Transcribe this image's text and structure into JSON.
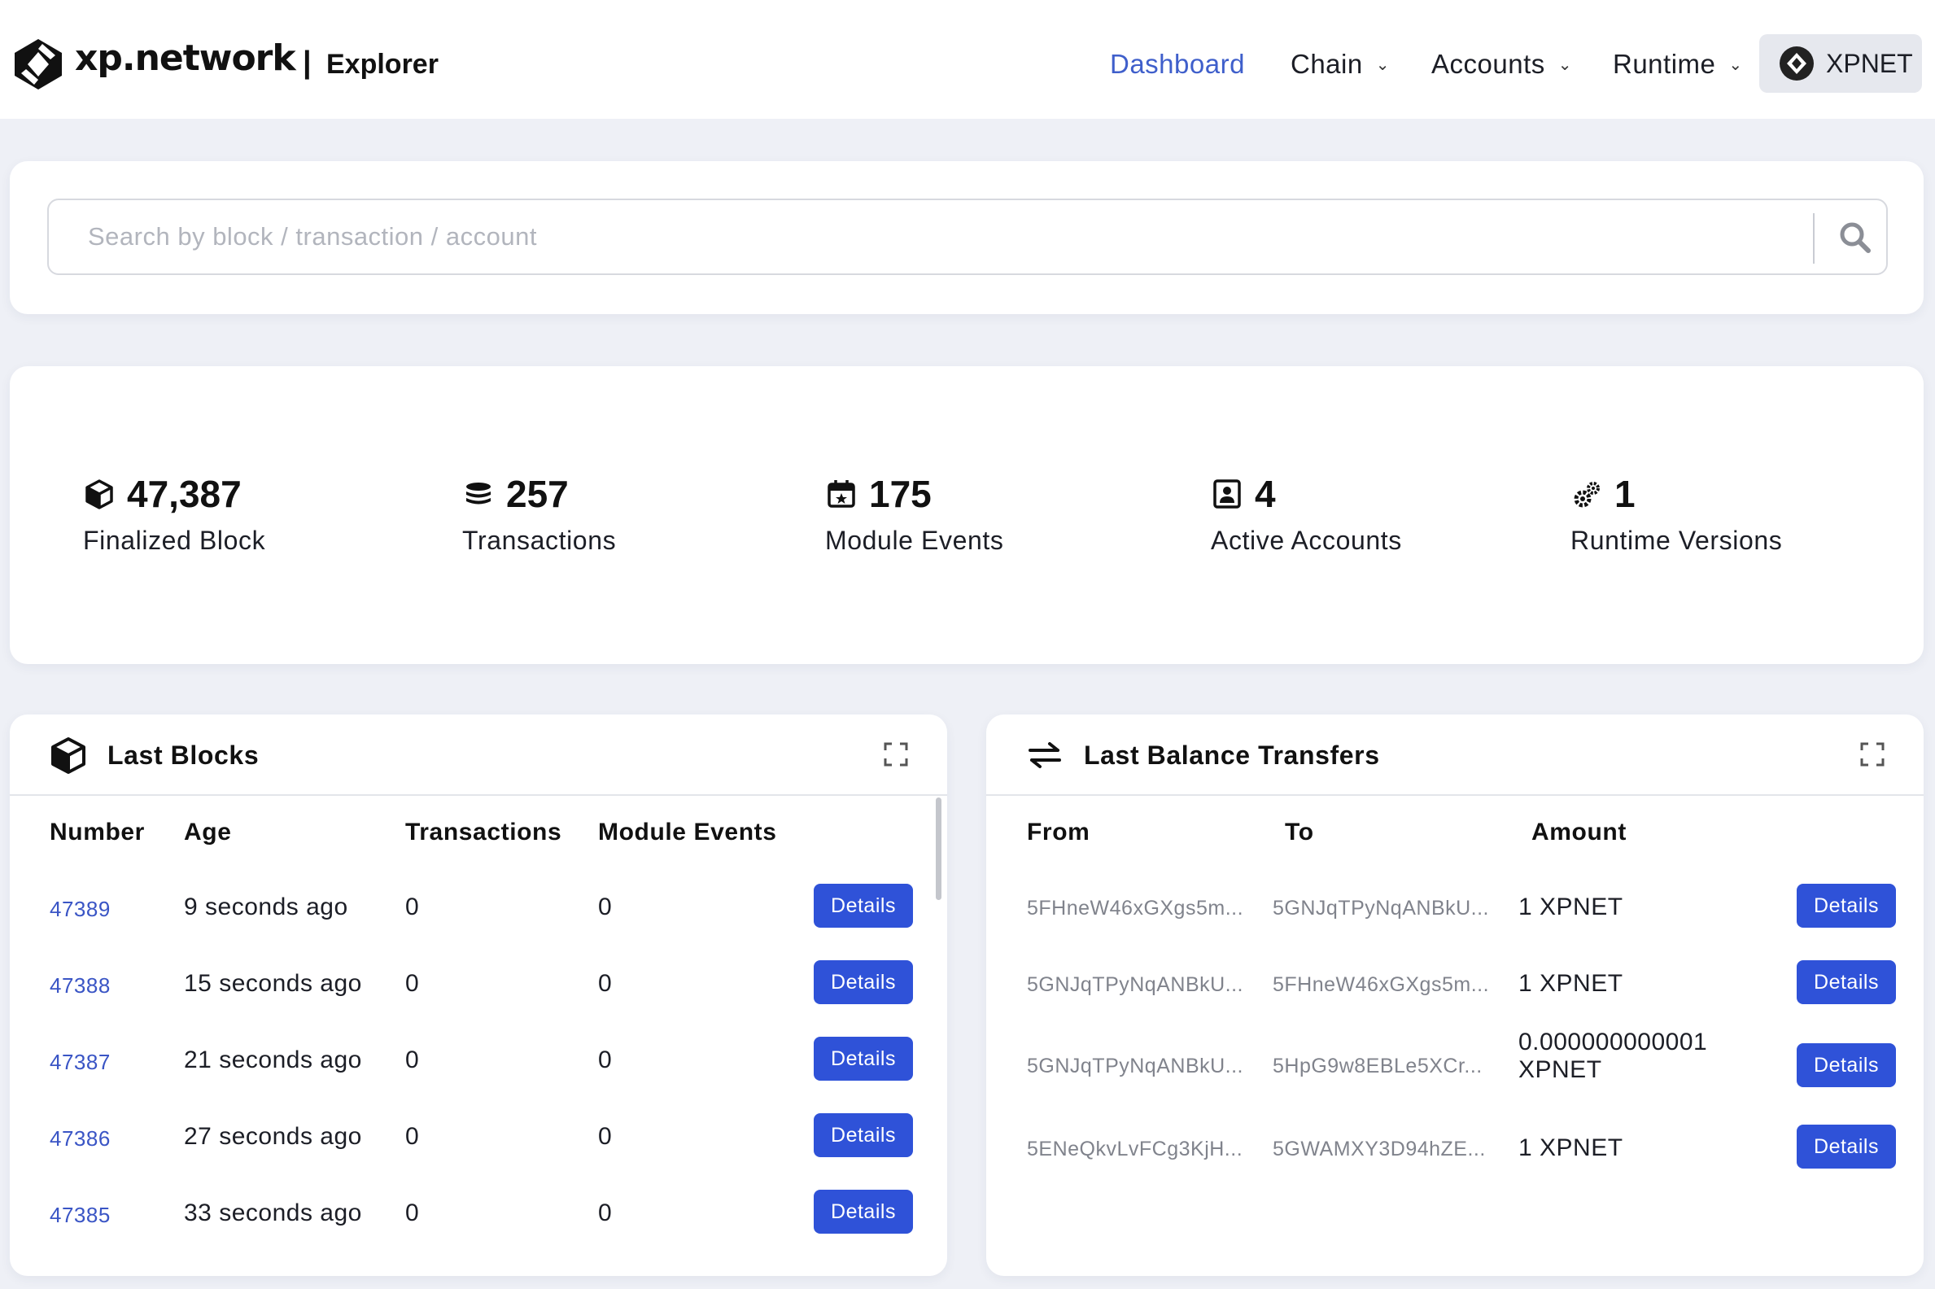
{
  "header": {
    "brand": "xp.network",
    "separator": "|",
    "subtitle": "Explorer",
    "nav": {
      "dashboard": "Dashboard",
      "chain": "Chain",
      "accounts": "Accounts",
      "runtime": "Runtime"
    },
    "network": "XPNET",
    "active_color": "#3f5fcb"
  },
  "search": {
    "placeholder": "Search by block / transaction / account",
    "value": ""
  },
  "stats": [
    {
      "icon": "cube-icon",
      "value": "47,387",
      "label": "Finalized Block"
    },
    {
      "icon": "coin-stack-icon",
      "value": "257",
      "label": "Transactions"
    },
    {
      "icon": "calendar-icon",
      "value": "175",
      "label": "Module Events"
    },
    {
      "icon": "contact-icon",
      "value": "4",
      "label": "Active Accounts"
    },
    {
      "icon": "gears-icon",
      "value": "1",
      "label": "Runtime Versions"
    }
  ],
  "last_blocks": {
    "title": "Last Blocks",
    "columns": [
      "Number",
      "Age",
      "Transactions",
      "Module Events"
    ],
    "rows": [
      {
        "number": "47389",
        "age": "9 seconds ago",
        "transactions": "0",
        "events": "0",
        "action": "Details"
      },
      {
        "number": "47388",
        "age": "15 seconds ago",
        "transactions": "0",
        "events": "0",
        "action": "Details"
      },
      {
        "number": "47387",
        "age": "21 seconds ago",
        "transactions": "0",
        "events": "0",
        "action": "Details"
      },
      {
        "number": "47386",
        "age": "27 seconds ago",
        "transactions": "0",
        "events": "0",
        "action": "Details"
      },
      {
        "number": "47385",
        "age": "33 seconds ago",
        "transactions": "0",
        "events": "0",
        "action": "Details"
      }
    ]
  },
  "last_transfers": {
    "title": "Last Balance Transfers",
    "columns": [
      "From",
      "To",
      "Amount"
    ],
    "rows": [
      {
        "from": "5FHneW46xGXgs5m...",
        "to": "5GNJqTPyNqANBkU...",
        "amount_line1": "1 XPNET",
        "amount_line2": "",
        "action": "Details"
      },
      {
        "from": "5GNJqTPyNqANBkU...",
        "to": "5FHneW46xGXgs5m...",
        "amount_line1": "1 XPNET",
        "amount_line2": "",
        "action": "Details"
      },
      {
        "from": "5GNJqTPyNqANBkU...",
        "to": "5HpG9w8EBLe5XCr...",
        "amount_line1": "0.000000000001",
        "amount_line2": "XPNET",
        "action": "Details"
      },
      {
        "from": "5ENeQkvLvFCg3KjH...",
        "to": "5GWAMXY3D94hZE...",
        "amount_line1": "1 XPNET",
        "amount_line2": "",
        "action": "Details"
      }
    ]
  },
  "colors": {
    "accent": "#2f52d8",
    "link": "#3a55c5",
    "background": "#eef0f6"
  }
}
